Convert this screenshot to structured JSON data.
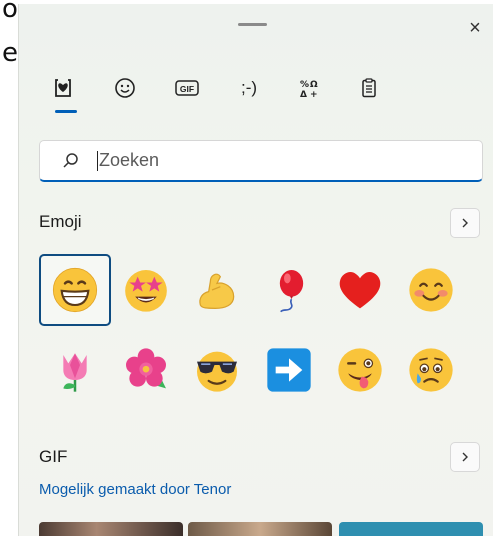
{
  "background_window": {
    "chars": [
      "o",
      "e"
    ]
  },
  "panel": {
    "close_label": "×"
  },
  "tabs": [
    {
      "name": "heart-clipboard-tab",
      "label": "Emoji"
    },
    {
      "name": "smiley-tab",
      "label": "☺"
    },
    {
      "name": "gif-tab",
      "label": "GIF"
    },
    {
      "name": "kaomoji-tab",
      "label": ";-)"
    },
    {
      "name": "symbols-tab",
      "label": "%Ω"
    },
    {
      "name": "clipboard-tab",
      "label": "📋"
    }
  ],
  "search": {
    "placeholder": "Zoeken"
  },
  "emoji_section": {
    "label": "Emoji",
    "emojis": [
      {
        "name": "grinning-face",
        "char": "😁"
      },
      {
        "name": "star-struck",
        "char": "🤩"
      },
      {
        "name": "flexed-biceps",
        "char": "💪"
      },
      {
        "name": "balloon",
        "char": "🎈"
      },
      {
        "name": "red-heart",
        "char": "❤"
      },
      {
        "name": "smiling-face-blush",
        "char": "😊"
      },
      {
        "name": "tulip",
        "char": "🌷"
      },
      {
        "name": "hibiscus",
        "char": "🌺"
      },
      {
        "name": "sunglasses-face",
        "char": "😎"
      },
      {
        "name": "right-arrow",
        "char": "➡"
      },
      {
        "name": "winking-tongue-face",
        "char": "😜"
      },
      {
        "name": "crying-face",
        "char": "😢"
      }
    ]
  },
  "gif_section": {
    "label": "GIF",
    "powered_by": "Mogelijk gemaakt door Tenor"
  },
  "colors": {
    "accent": "#005fb8",
    "selection_border": "#0f4c81",
    "link": "#0b5cad"
  }
}
